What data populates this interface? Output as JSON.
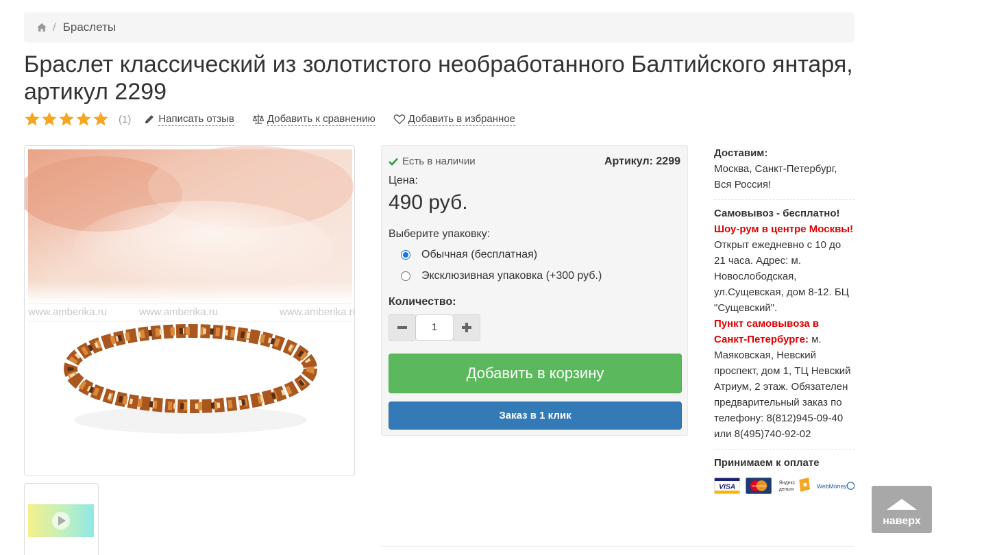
{
  "breadcrumb": {
    "home_icon": "home-icon",
    "separator": "/",
    "current": "Браслеты"
  },
  "product": {
    "title": "Браслет классический из золотистого необработанного Балтийского янтаря, артикул 2299",
    "rating": 5,
    "review_count": "(1)",
    "actions": {
      "review": "Написать отзыв",
      "compare": "Добавить к сравнению",
      "favorite": "Добавить в избранное"
    },
    "image_watermark": "www.amberika.ru"
  },
  "buy": {
    "stock": "Есть в наличии",
    "sku": "Артикул: 2299",
    "price_label": "Цена:",
    "price": "490 руб.",
    "pack_label": "Выберите упаковку:",
    "pack_options": [
      {
        "label": "Обычная (бесплатная)",
        "selected": true
      },
      {
        "label": "Эксклюзивная упаковка (+300 руб.)",
        "selected": false
      }
    ],
    "qty_label": "Количество:",
    "qty_value": "1",
    "qty_minus": "−",
    "qty_plus": "+",
    "add_to_cart": "Добавить в корзину",
    "one_click": "Заказ в 1 клик"
  },
  "info": {
    "delivery_title": "Доставим:",
    "delivery_text": "Москва, Санкт-Петербург, Вся Россия!",
    "pickup_title": "Самовывоз - бесплатно!",
    "showroom_label": "Шоу-рум в центре Москвы!",
    "showroom_text": "Открыт ежедневно с 10 до 21 часа. Адрес: м. Новослободская, ул.Сущевская, дом 8-12. БЦ \"Сущевский\".",
    "spb_label": "Пункт самовывоза в Санкт-Петербурге:",
    "spb_text": "м. Маяковская, Невский проспект, дом 1, ТЦ Невский Атриум, 2 этаж. Обязателен предварительный заказ по телефону: 8(812)945-09-40 или 8(495)740-92-02",
    "payment_title": "Принимаем к оплате",
    "payment_methods": [
      "VISA",
      "MasterCard",
      "Яндекс деньги",
      "WebMoney"
    ]
  },
  "to_top": "наверх",
  "colors": {
    "green": "#5cb85c",
    "blue": "#337ab7",
    "star": "#f5a623",
    "red": "#e00000"
  }
}
